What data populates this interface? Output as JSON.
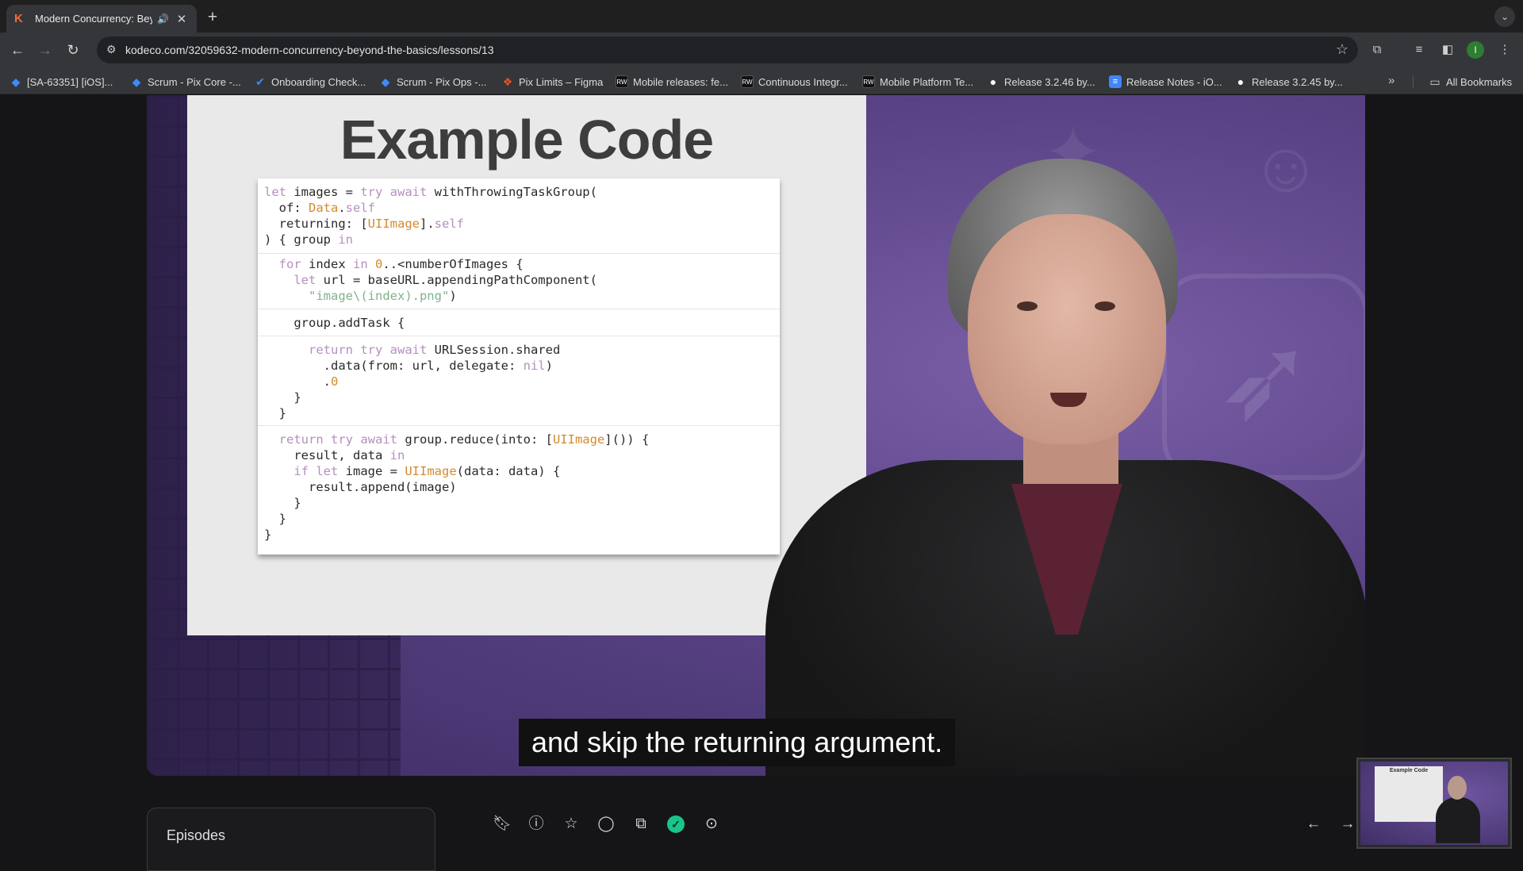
{
  "browser": {
    "tab": {
      "title": "Modern Concurrency: Beyond the Basics",
      "favicon": "K"
    },
    "new_tab": "+",
    "url": "kodeco.com/32059632-modern-concurrency-beyond-the-basics/lessons/13",
    "profile_initial": "I",
    "bookmarks": [
      {
        "label": "[SA-63351] [iOS]...",
        "icon": "jira"
      },
      {
        "label": "Scrum - Pix Core -...",
        "icon": "jira"
      },
      {
        "label": "Onboarding Check...",
        "icon": "jira-check"
      },
      {
        "label": "Scrum - Pix Ops -...",
        "icon": "jira"
      },
      {
        "label": "Pix Limits – Figma",
        "icon": "figma"
      },
      {
        "label": "Mobile releases: fe...",
        "icon": "rw"
      },
      {
        "label": "Continuous Integr...",
        "icon": "rw"
      },
      {
        "label": "Mobile Platform Te...",
        "icon": "rw"
      },
      {
        "label": "Release 3.2.46 by...",
        "icon": "github"
      },
      {
        "label": "Release Notes - iO...",
        "icon": "doc"
      },
      {
        "label": "Release 3.2.45 by...",
        "icon": "github"
      }
    ],
    "bookmarks_more": "»",
    "all_bookmarks": "All Bookmarks"
  },
  "video": {
    "slide_title": "Example Code",
    "code_lines": [
      "let images = try await withThrowingTaskGroup(",
      "  of: Data.self",
      "  returning: [UIImage].self",
      ") { group in",
      "  for index in 0..<numberOfImages {",
      "    let url = baseURL.appendingPathComponent(",
      "      \"image\\(index).png\")",
      "    group.addTask {",
      "      return try await URLSession.shared",
      "        .data(from: url, delegate: nil)",
      "        .0",
      "    }",
      "  }",
      "  return try await group.reduce(into: [UIImage]()) {",
      "    result, data in",
      "    if let image = UIImage(data: data) {",
      "      result.append(image)",
      "    }",
      "  }",
      "}"
    ],
    "caption": "and skip the returning argument."
  },
  "controls": {
    "episodes_label": "Episodes",
    "icons": [
      "bookmark-icon",
      "info-icon",
      "star-icon",
      "comment-icon",
      "popout-icon",
      "complete-icon",
      "github-icon"
    ],
    "prev": "←",
    "next": "→"
  },
  "pip": {
    "title": "Example Code"
  },
  "colors": {
    "keyword": "#b58fbf",
    "type": "#d48a2e",
    "string": "#7fb38a",
    "complete": "#19c58a",
    "accent": "#f26b3a"
  }
}
